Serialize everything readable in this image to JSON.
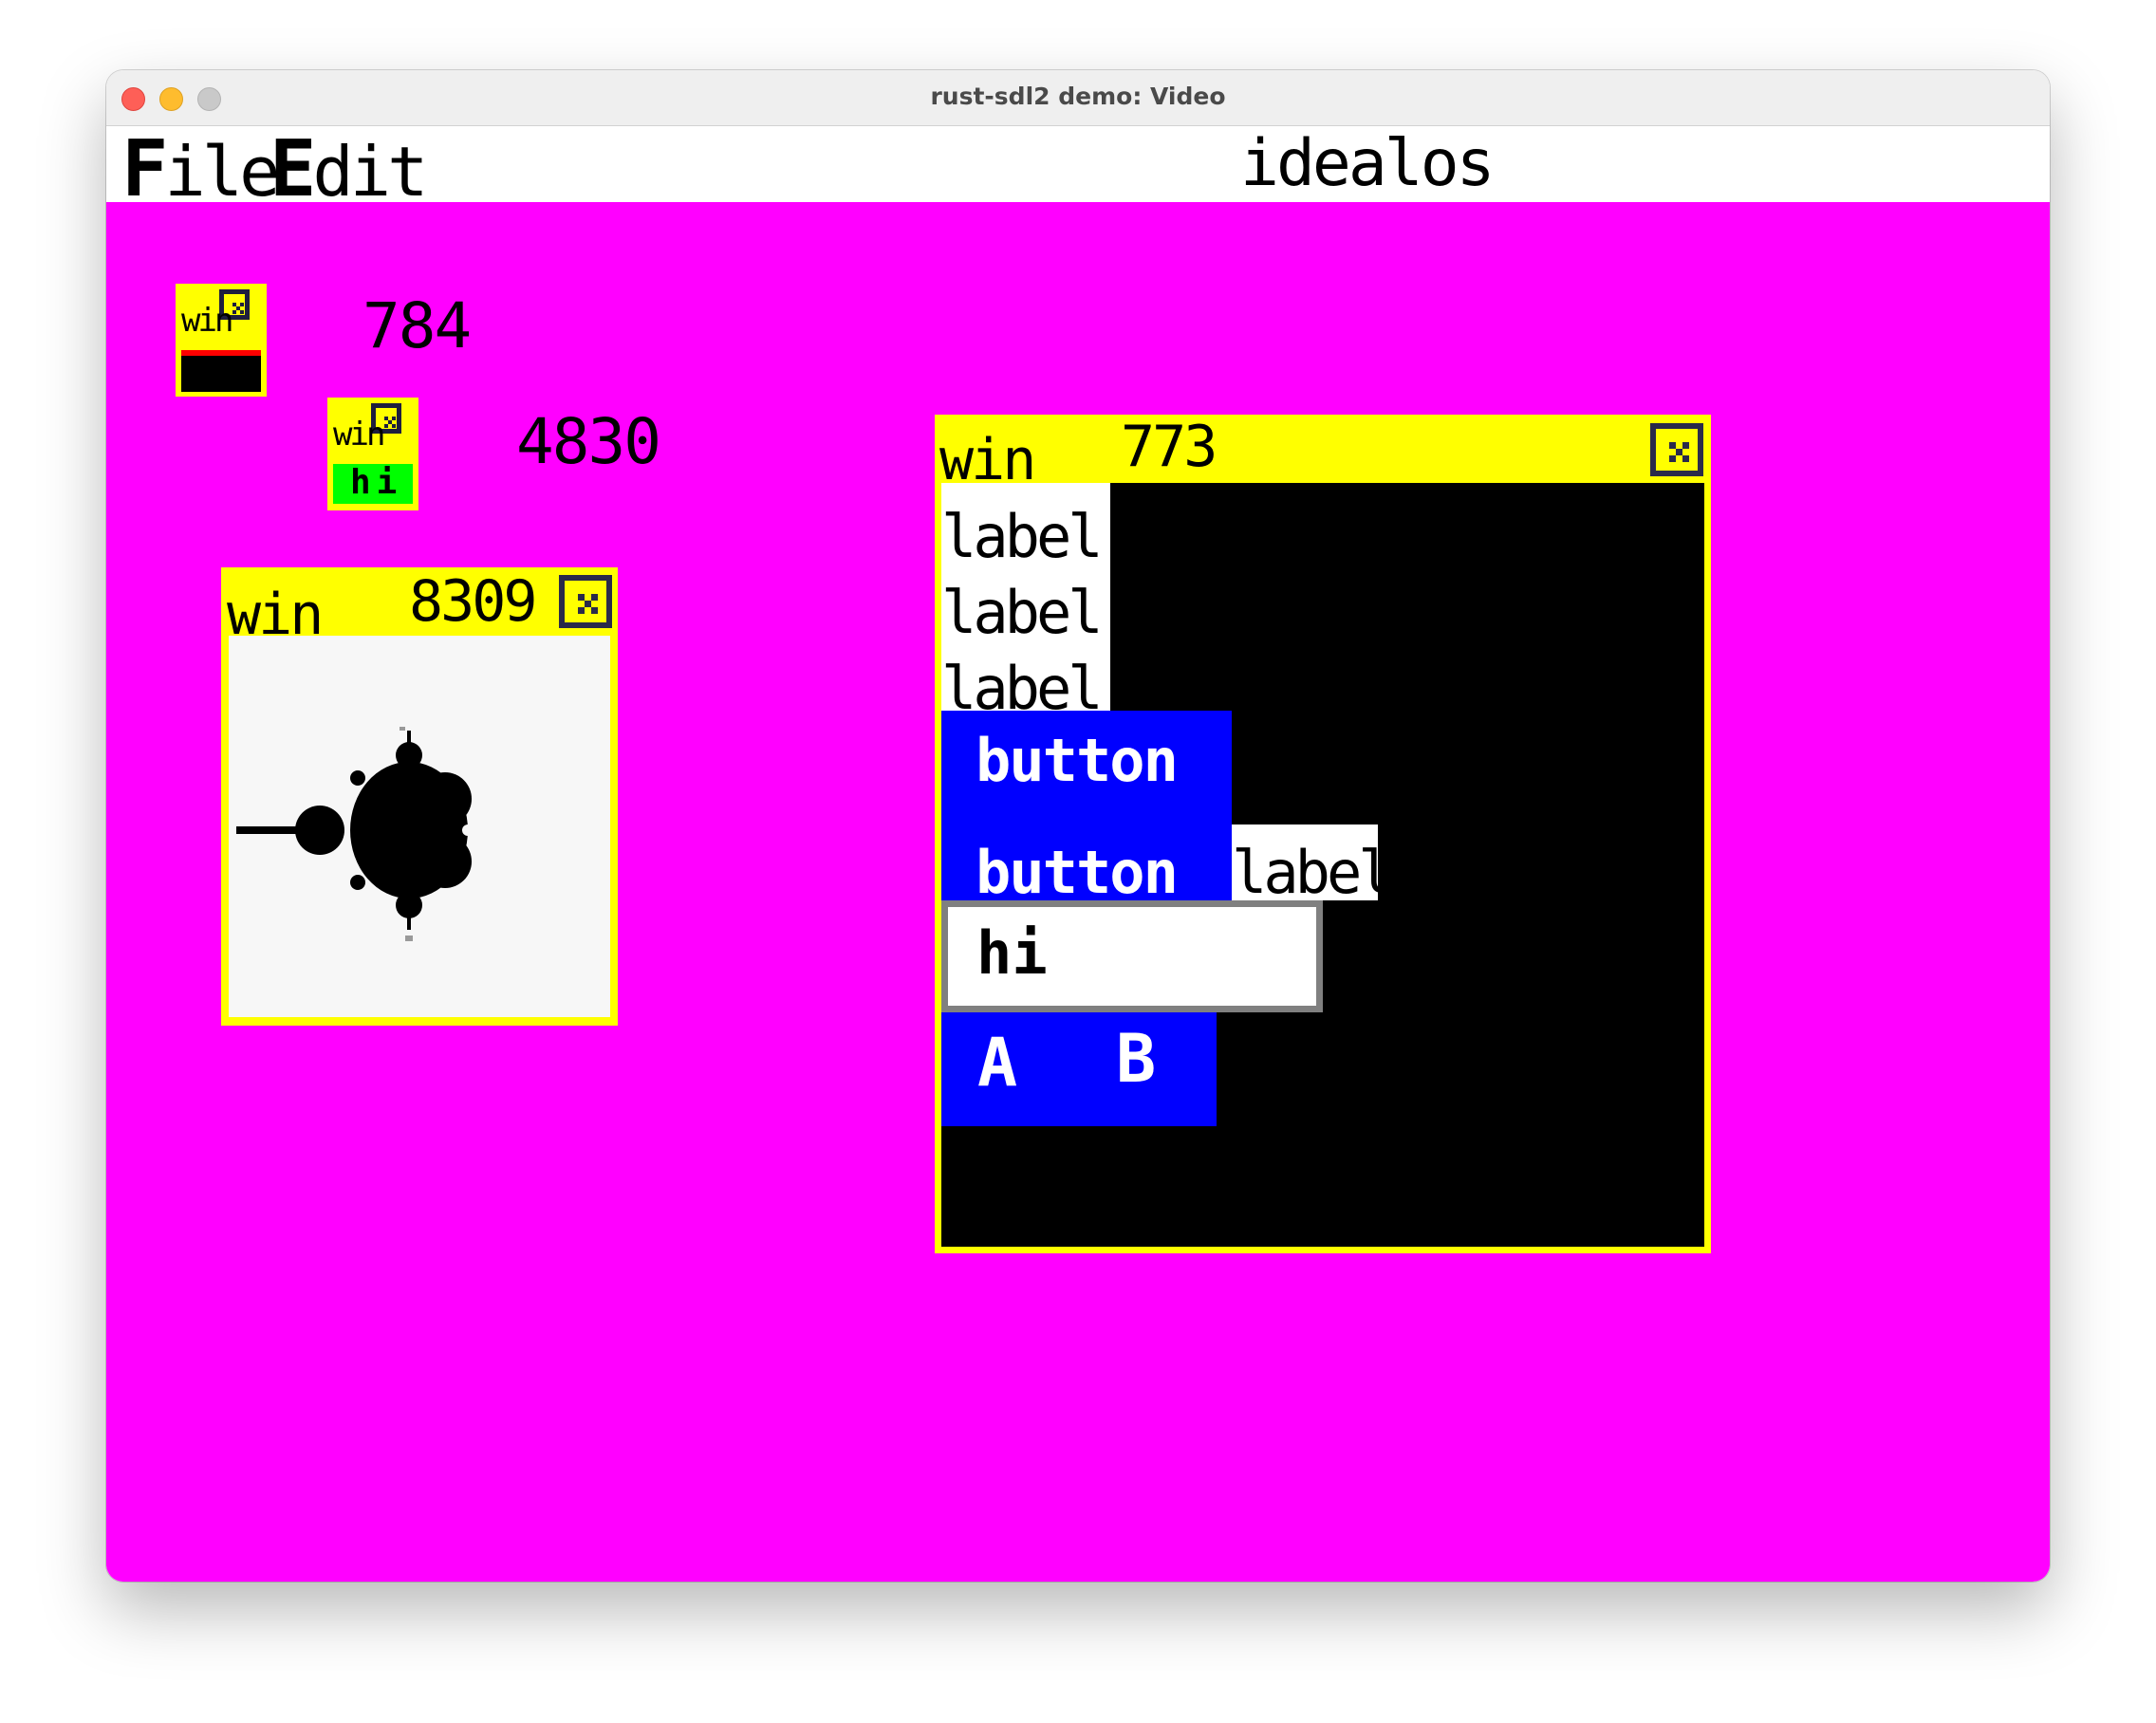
{
  "window": {
    "title": "rust-sdl2 demo: Video"
  },
  "menubar": {
    "file": {
      "cap": "F",
      "rest": "ile"
    },
    "edit": {
      "cap": "E",
      "rest": "dit"
    },
    "app_name": "idealos"
  },
  "desktop": {
    "background_color": "#ff00ff",
    "mini_window_1": {
      "title": "win",
      "status_color": "#000000",
      "counter": "784"
    },
    "mini_window_2": {
      "title": "win",
      "status_text": "hi",
      "status_color": "#00ff00",
      "counter": "4830"
    },
    "fractal_window": {
      "title": "win",
      "counter": "8309",
      "image": "mandelbrot-set"
    },
    "widget_window": {
      "title": "win",
      "counter": "773",
      "labels": [
        "label",
        "label",
        "label"
      ],
      "button_1": "button",
      "button_2": "button",
      "side_label": "label",
      "input_value": "hi",
      "toggle_a": "A",
      "toggle_b": "B"
    }
  },
  "colors": {
    "window_yellow": "#ffff00",
    "button_blue": "#0000ff",
    "close_border": "#2a2a4a"
  }
}
